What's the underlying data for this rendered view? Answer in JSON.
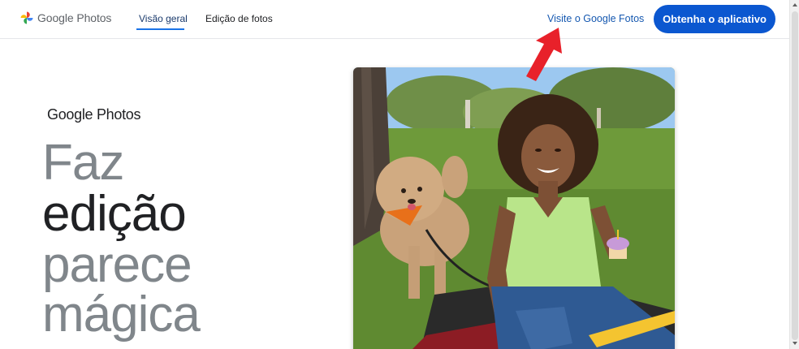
{
  "header": {
    "logo_text": "Google Photos",
    "nav": [
      {
        "label": "Visão geral",
        "active": true
      },
      {
        "label": "Edição de fotos",
        "active": false
      }
    ],
    "visit_link": "Visite o Google Fotos",
    "app_button": "Obtenha o aplicativo"
  },
  "hero": {
    "brand": "Google Photos",
    "line1": "Faz",
    "line2": "edição",
    "line3": "parece",
    "line4": "mágica"
  },
  "icons": {
    "logo": "google-photos-pinwheel-icon",
    "annotation": "red-arrow-icon"
  },
  "colors": {
    "accent": "#0b57d0",
    "link": "#1558b0",
    "hero_grey": "#80868b",
    "hero_dark": "#202124",
    "annotation": "#e8212a"
  }
}
